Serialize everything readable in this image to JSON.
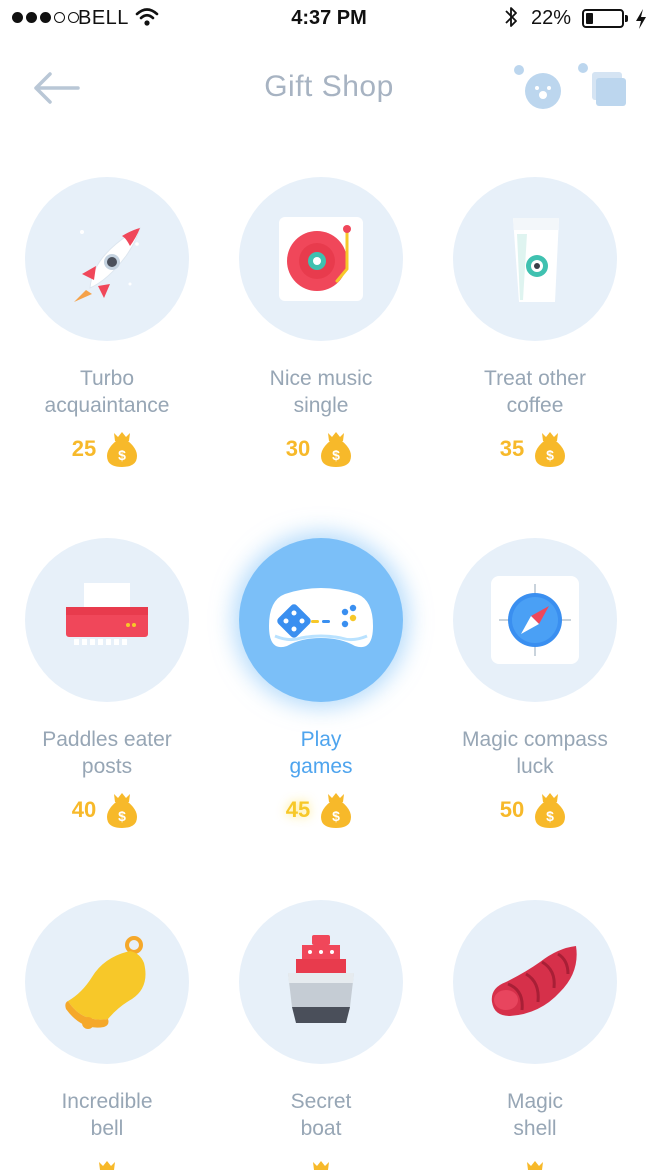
{
  "status_bar": {
    "carrier": "BELL",
    "time": "4:37 PM",
    "battery_percent": "22%",
    "battery_level": 0.22
  },
  "nav": {
    "title": "Gift Shop",
    "back_icon": "back-arrow-icon",
    "face_icon": "face-icon",
    "cards_icon": "stacked-cards-icon"
  },
  "gifts": [
    {
      "line1": "Turbo",
      "line2": "acquaintance",
      "price": "25",
      "icon": "rocket-icon"
    },
    {
      "line1": "Nice music",
      "line2": "single",
      "price": "30",
      "icon": "record-player-icon"
    },
    {
      "line1": "Treat other",
      "line2": "coffee",
      "price": "35",
      "icon": "coffee-cup-icon"
    },
    {
      "line1": "Paddles eater",
      "line2": "posts",
      "price": "40",
      "icon": "shredder-icon"
    },
    {
      "line1": "Play",
      "line2": "games",
      "price": "45",
      "icon": "gamepad-icon",
      "selected": true
    },
    {
      "line1": "Magic compass",
      "line2": "luck",
      "price": "50",
      "icon": "compass-icon"
    },
    {
      "line1": "Incredible",
      "line2": "bell",
      "price": "",
      "icon": "bell-icon"
    },
    {
      "line1": "Secret",
      "line2": "boat",
      "price": "",
      "icon": "ship-icon"
    },
    {
      "line1": "Magic",
      "line2": "shell",
      "price": "",
      "icon": "shell-icon"
    }
  ],
  "colors": {
    "title": "#a7b3c2",
    "circle_bg": "#e7f0f9",
    "active_circle": "#7bbff8",
    "label": "#97a6b5",
    "active_label": "#4ea4ee",
    "price": "#f7b92a"
  }
}
